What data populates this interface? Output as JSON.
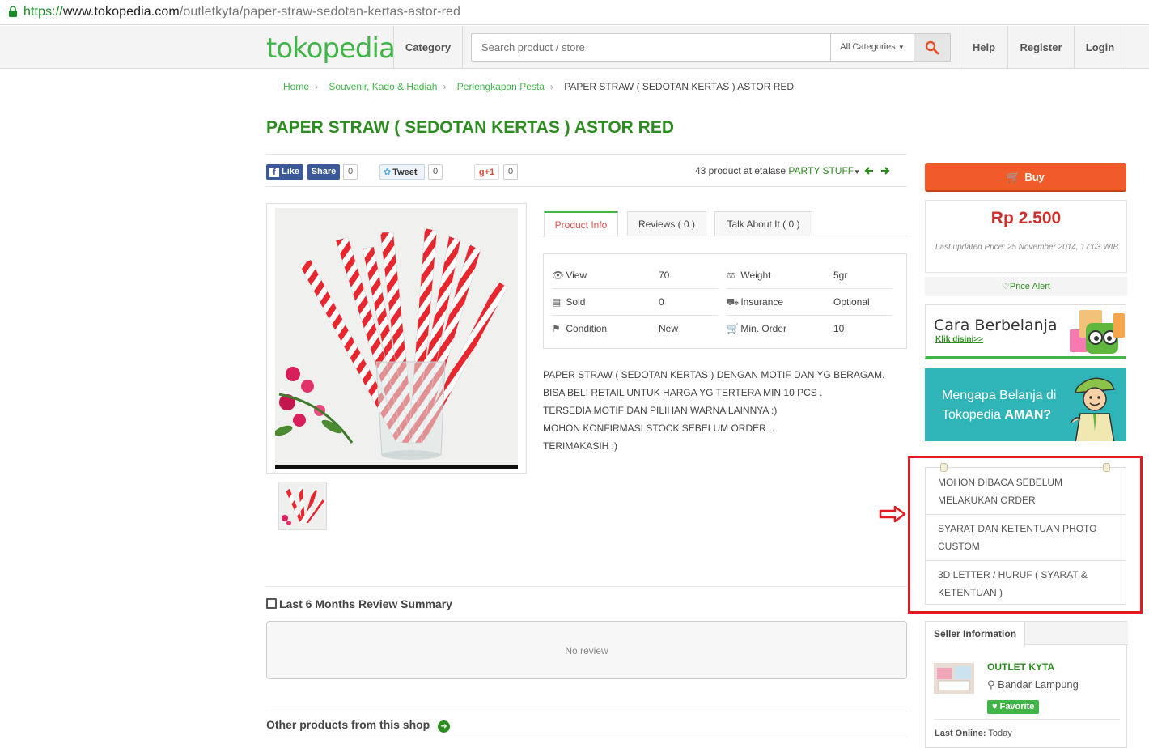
{
  "browser": {
    "url_scheme": "https://",
    "url_host": "www.tokopedia.com",
    "url_path": "/outletkyta/paper-straw-sedotan-kertas-astor-red"
  },
  "header": {
    "logo": "tokopedia",
    "category": "Category",
    "search_placeholder": "Search product / store",
    "all_categories": "All Categories",
    "help": "Help",
    "register": "Register",
    "login": "Login"
  },
  "breadcrumb": [
    "Home",
    "Souvenir, Kado & Hadiah",
    "Perlengkapan Pesta",
    "PAPER STRAW ( SEDOTAN KERTAS ) ASTOR RED"
  ],
  "product": {
    "title": "PAPER STRAW ( SEDOTAN KERTAS ) ASTOR RED",
    "social": {
      "like": "Like",
      "share": "Share",
      "fb_count": "0",
      "tweet": "Tweet",
      "tw_count": "0",
      "gplus": "+1",
      "gp_count": "0"
    },
    "etalase_text": "43 product at etalase",
    "etalase_name": "PARTY STUFF",
    "tabs": {
      "info": "Product Info",
      "reviews": "Reviews ( 0 )",
      "talk": "Talk About It ( 0 )"
    },
    "info": {
      "view_label": "View",
      "view_value": "70",
      "weight_label": "Weight",
      "weight_value": "5gr",
      "sold_label": "Sold",
      "sold_value": "0",
      "insurance_label": "Insurance",
      "insurance_value": "Optional",
      "condition_label": "Condition",
      "condition_value": "New",
      "min_order_label": "Min. Order",
      "min_order_value": "10"
    },
    "description": [
      "PAPER STRAW ( SEDOTAN KERTAS ) DENGAN MOTIF DAN YG BERAGAM.",
      "BISA BELI RETAIL UNTUK HARGA YG TERTERA MIN 10 PCS .",
      "TERSEDIA MOTIF DAN PILIHAN WARNA LAINNYA :)",
      "MOHON KONFIRMASI STOCK SEBELUM ORDER ..",
      "TERIMAKASIH :)"
    ]
  },
  "reviews": {
    "title": "Last 6 Months Review Summary",
    "empty": "No review",
    "other_products": "Other products from this shop"
  },
  "sidebar": {
    "buy": "Buy",
    "price": "Rp 2.500",
    "last_updated": "Last updated Price: 25 November 2014, 17:03 WIB",
    "price_alert": "Price Alert",
    "banner1_title": "Cara Berbelanja",
    "banner1_link": "Klik disini>>",
    "banner2_line1": "Mengapa Belanja di",
    "banner2_line2": "Tokopedia",
    "banner2_bold": "AMAN?",
    "notes": [
      "MOHON DIBACA SEBELUM MELAKUKAN ORDER",
      "SYARAT DAN KETENTUAN PHOTO CUSTOM",
      "3D LETTER / HURUF ( SYARAT & KETENTUAN )"
    ],
    "seller_tab": "Seller Information",
    "shop_name": "OUTLET KYTA",
    "shop_location": "Bandar Lampung",
    "favorite": "Favorite",
    "last_online_label": "Last Online:",
    "last_online_value": "Today"
  },
  "colors": {
    "brand_green": "#42b549",
    "title_green": "#2d8c1f",
    "buy_orange": "#f15a29",
    "price_red": "#c9302c",
    "annotation_red": "#e21b23"
  }
}
